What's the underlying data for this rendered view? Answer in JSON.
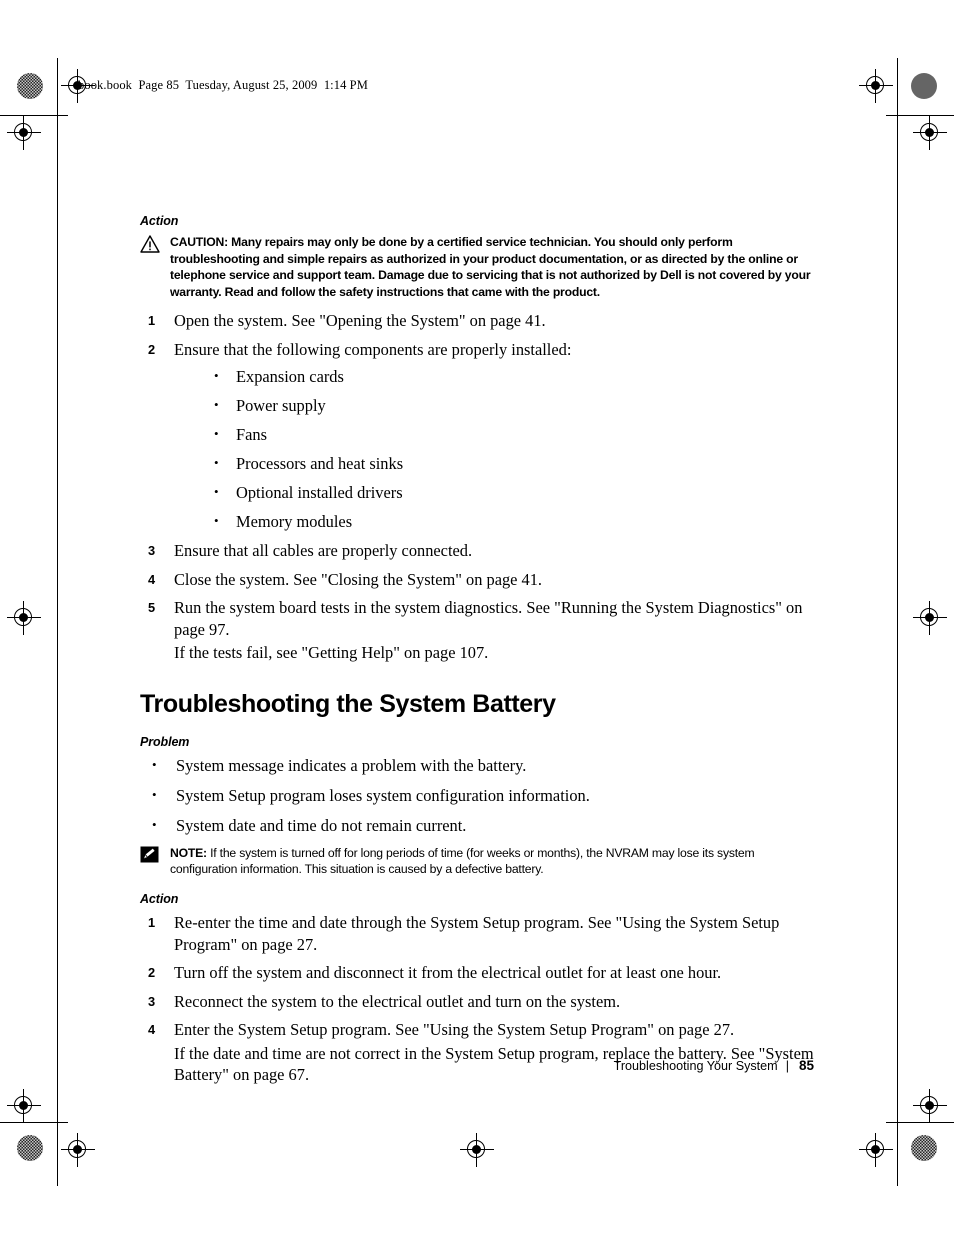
{
  "slugline": "book.book  Page 85  Tuesday, August 25, 2009  1:14 PM",
  "section_one": {
    "action_label": "Action",
    "caution": {
      "icon": "warning-triangle-icon",
      "keyword": "CAUTION:",
      "text": " Many repairs may only be done by a certified service technician. You should only perform troubleshooting and simple repairs as authorized in your product documentation, or as directed by the online or telephone service and support team. Damage due to servicing that is not authorized by Dell is not covered by your warranty. Read and follow the safety instructions that came with the product."
    },
    "steps": [
      {
        "num": "1",
        "text": "Open the system. See \"Opening the System\" on page 41."
      },
      {
        "num": "2",
        "text": "Ensure that the following components are properly installed:"
      },
      {
        "num": "3",
        "text": "Ensure that all cables are properly connected."
      },
      {
        "num": "4",
        "text": "Close the system. See \"Closing the System\" on page 41."
      },
      {
        "num": "5",
        "text": "Run the system board tests in the system diagnostics. See \"Running the System Diagnostics\" on page 97."
      }
    ],
    "components": [
      "Expansion cards",
      "Power supply",
      "Fans",
      "Processors and heat sinks",
      "Optional installed drivers",
      "Memory modules"
    ],
    "step5_followup": "If the tests fail, see \"Getting Help\" on page 107."
  },
  "section_two": {
    "heading": "Troubleshooting the System Battery",
    "problem_label": "Problem",
    "problems": [
      "System message indicates a problem with the battery.",
      "System Setup program loses system configuration information.",
      "System date and time do not remain current."
    ],
    "note": {
      "icon": "pencil-note-icon",
      "keyword": "NOTE:",
      "text": " If the system is turned off for long periods of time (for weeks or months), the NVRAM may lose its system configuration information. This situation is caused by a defective battery."
    },
    "action_label": "Action",
    "steps": [
      {
        "num": "1",
        "text": "Re-enter the time and date through the System Setup program. See \"Using the System Setup Program\" on page 27."
      },
      {
        "num": "2",
        "text": "Turn off the system and disconnect it from the electrical outlet for at least one hour."
      },
      {
        "num": "3",
        "text": "Reconnect the system to the electrical outlet and turn on the system."
      },
      {
        "num": "4",
        "text": "Enter the System Setup program. See \"Using the System Setup Program\" on page 27."
      }
    ],
    "step4_followup": "If the date and time are not correct in the System Setup program, replace the battery. See \"System Battery\" on page 67."
  },
  "footer": {
    "chapter": "Troubleshooting Your System",
    "separator": "|",
    "page_number": "85"
  },
  "colors": {
    "text": "#000000",
    "background": "#ffffff",
    "marks": "#000000"
  }
}
